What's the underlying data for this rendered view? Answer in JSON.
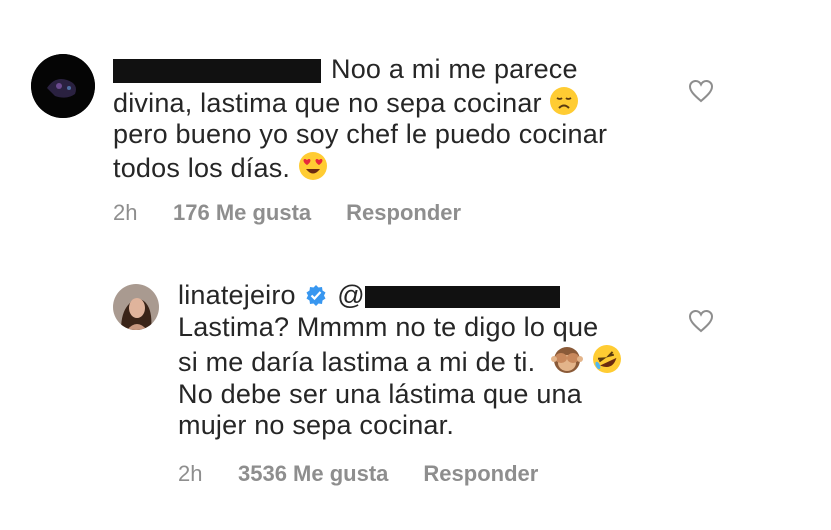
{
  "comments": [
    {
      "username": "",
      "text_lines": [
        "Noo a mi me parece",
        "divina, lastima que no sepa cocinar",
        "pero bueno yo soy chef le puedo cocinar",
        "todos los días."
      ],
      "emojis": [
        "disappointed-face",
        "heart-eyes-face"
      ],
      "time": "2h",
      "likes": "176 Me gusta",
      "reply": "Responder"
    },
    {
      "username": "linatejeiro",
      "mention": "@",
      "verified": true,
      "text_lines": [
        "Lastima? Mmmm no te digo lo que",
        "si me daría lastima a mi de ti.",
        "No debe ser una lástima que una",
        "mujer no sepa cocinar."
      ],
      "emojis": [
        "see-no-evil-monkey",
        "rolling-on-floor-laughing"
      ],
      "time": "2h",
      "likes": "3536 Me gusta",
      "reply": "Responder"
    }
  ],
  "colors": {
    "text": "#262626",
    "meta": "#8e8e8e",
    "verified": "#3897f0"
  }
}
